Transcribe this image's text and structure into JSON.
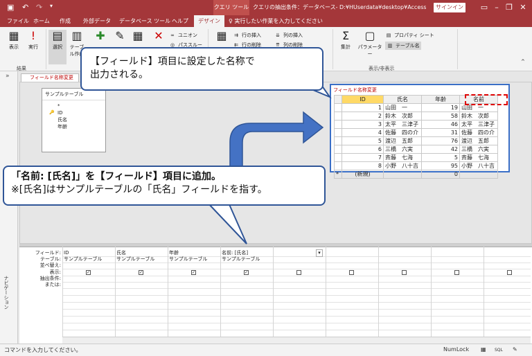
{
  "title_bar": {
    "context_tab": "クエリ ツール",
    "document_title": "クエリの抽出条件：データベース- D:¥HUserdata¥desktop¥Access紹介¥クエリの抽…",
    "sign_in": "サインイン",
    "undo_icon": "undo-icon",
    "save_icon": "save-icon"
  },
  "tabs": [
    "ファイル",
    "ホーム",
    "作成",
    "外部データ",
    "データベース ツール",
    "ヘルプ",
    "デザイン"
  ],
  "active_tab": "デザイン",
  "tell_me": "実行したい作業を入力してください",
  "ribbon": {
    "view": "表示",
    "run": "実行",
    "select": "選択",
    "make_table": "テーブル作成",
    "union": "ユニオン",
    "passthrough": "パススルー",
    "insert_row": "行の挿入",
    "delete_row": "行の削除",
    "insert_col": "列の挿入",
    "delete_col": "列の削除",
    "totals": "集計",
    "parameters": "パラメーター",
    "property_sheet": "プロパティ シート",
    "table_names": "テーブル名",
    "group_results": "結果",
    "group_show_hide": "表示/非表示"
  },
  "nav_pane": {
    "label": "ナビゲーション"
  },
  "design_tab": "フィールド名称変更",
  "source_table": {
    "name": "サンプルテーブル",
    "fields": [
      "*",
      "ID",
      "氏名",
      "年齢"
    ]
  },
  "grid": {
    "row_labels": [
      "フィールド:",
      "テーブル:",
      "並べ替え:",
      "表示:",
      "抽出条件:",
      "または:"
    ],
    "columns": [
      {
        "field": "ID",
        "table": "サンプルテーブル",
        "show": true
      },
      {
        "field": "氏名",
        "table": "サンプルテーブル",
        "show": true
      },
      {
        "field": "年齢",
        "table": "サンプルテーブル",
        "show": true
      },
      {
        "field": "名前: [氏名]",
        "table": "サンプルテーブル",
        "show": true
      },
      {
        "field": "",
        "table": "",
        "show": false
      },
      {
        "field": "",
        "table": "",
        "show": false
      },
      {
        "field": "",
        "table": "",
        "show": false
      },
      {
        "field": "",
        "table": "",
        "show": false
      },
      {
        "field": "",
        "table": "",
        "show": false
      }
    ]
  },
  "datasheet": {
    "tab": "フィールド名称変更",
    "headers": [
      "ID",
      "氏名",
      "年齢",
      "名前"
    ],
    "rows": [
      [
        "1",
        "山田　一",
        "19",
        "山田　一"
      ],
      [
        "2",
        "鈴木　次郎",
        "58",
        "鈴木　次郎"
      ],
      [
        "3",
        "太平　三津子",
        "46",
        "太平　三津子"
      ],
      [
        "4",
        "佐藤　四の介",
        "31",
        "佐藤　四の介"
      ],
      [
        "5",
        "渡辺　五郎",
        "76",
        "渡辺　五郎"
      ],
      [
        "6",
        "三橋　六実",
        "42",
        "三橋　六実"
      ],
      [
        "7",
        "斉藤　七海",
        "5",
        "斉藤　七海"
      ],
      [
        "8",
        "小野　八十吉",
        "95",
        "小野　八十吉"
      ]
    ],
    "new_row": [
      "(新規)",
      "",
      "0",
      ""
    ]
  },
  "callout1": {
    "line1": "【フィールド】項目に設定した名称で",
    "line2": "出力される。"
  },
  "callout2": {
    "line1": "「名前: [氏名]」を【フィールド】項目に追加。",
    "line2": "※[氏名]はサンプルテーブルの「氏名」フィールドを指す。"
  },
  "status": {
    "message": "コマンドを入力してください。",
    "numlock": "NumLock"
  },
  "colors": {
    "accent": "#a4373a",
    "callout_border": "#2f5597",
    "highlight": "#d00000"
  }
}
